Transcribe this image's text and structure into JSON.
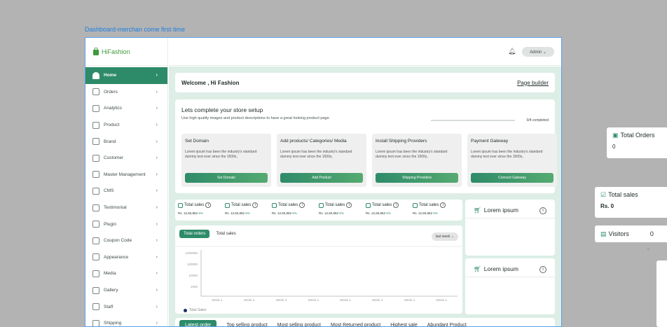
{
  "canvas_label": "Dashboard-merchan come first time",
  "brand": {
    "name": "HiFashion"
  },
  "header": {
    "user": "Admin ⌄"
  },
  "sidebar": {
    "items": [
      {
        "label": "Home",
        "icon": "home-icon"
      },
      {
        "label": "Orders",
        "icon": "orders-icon"
      },
      {
        "label": "Analytics",
        "icon": "analytics-icon"
      },
      {
        "label": "Product",
        "icon": "product-icon"
      },
      {
        "label": "Brand",
        "icon": "brand-icon"
      },
      {
        "label": "Customer",
        "icon": "customer-icon"
      },
      {
        "label": "Master Management",
        "icon": "master-icon"
      },
      {
        "label": "CMS",
        "icon": "cms-icon"
      },
      {
        "label": "Testimonial",
        "icon": "testimonial-icon"
      },
      {
        "label": "Plugin",
        "icon": "plugin-icon"
      },
      {
        "label": "Coupon Code",
        "icon": "coupon-icon"
      },
      {
        "label": "Appearance",
        "icon": "appearance-icon"
      },
      {
        "label": "Media",
        "icon": "media-icon"
      },
      {
        "label": "Gallery",
        "icon": "gallery-icon"
      },
      {
        "label": "Staff",
        "icon": "staff-icon"
      },
      {
        "label": "Shipping",
        "icon": "shipping-icon"
      }
    ]
  },
  "welcome": {
    "title": "Welcome , Hi Fashion",
    "page_builder": "Page builder"
  },
  "setup": {
    "title": "Lets complete your store setup",
    "subtitle": "Use high quality images and product descriptions to have a great looking product page.",
    "progress_text": "0/4 completed",
    "progress": 0,
    "steps": [
      {
        "title": "Set Domain",
        "desc": "Lorem ipsum has been the industry's standard dummy text ever since the 1500s,",
        "button": "Set Domain"
      },
      {
        "title": "Add products/ Categories/ Media",
        "desc": "Lorem ipsum has been the industry's standard dummy text ever since the 1500s,",
        "button": "Add Product"
      },
      {
        "title": "Install Shipping Providers",
        "desc": "Lorem ipsum has been the industry's standard dummy text ever since the 1500s,",
        "button": "Shipping Providers"
      },
      {
        "title": "Payment Gateway",
        "desc": "Lorem ipsum has been the industry's standard dummy text ever since the 1500s,",
        "button": "Connect Gateway"
      }
    ]
  },
  "stats": [
    {
      "label": "Total sales",
      "value": "Rs. 12,50,852",
      "pct": "5%"
    },
    {
      "label": "Total sales",
      "value": "Rs. 12,50,852",
      "pct": "5%"
    },
    {
      "label": "Total sales",
      "value": "Rs. 12,50,852",
      "pct": "5%"
    },
    {
      "label": "Total sales",
      "value": "Rs. 12,50,852",
      "pct": "5%"
    },
    {
      "label": "Total sales",
      "value": "Rs. 12,50,852",
      "pct": "5%"
    },
    {
      "label": "Total sales",
      "value": "Rs. 12,50,852",
      "pct": "5%"
    }
  ],
  "chart_tabs": {
    "active": "Total orders",
    "other": "Total sales",
    "period": "last week ⌄"
  },
  "chart_data": {
    "type": "line",
    "categories": [
      "Week 1",
      "Week 2",
      "Week 3",
      "Week 4",
      "Week 4",
      "Week 4",
      "Week 4",
      "Week 4"
    ],
    "y_ticks": [
      "1000000",
      "100000",
      "10000",
      "1000"
    ],
    "series": [
      {
        "name": "Total Sales",
        "values": []
      }
    ]
  },
  "side_cards": [
    {
      "title": "Lorem ipsum"
    },
    {
      "title": "Lorem ipsum"
    }
  ],
  "bottom_tabs": [
    "Latest order",
    "Top selling product",
    "Most selling product",
    "Most Returned product",
    "Highest sale",
    "Abundant Product"
  ],
  "floating": {
    "orders": {
      "label": "Total Orders",
      "value": "0"
    },
    "sales": {
      "label": "Total sales",
      "value": "Rs. 0"
    },
    "visitors": {
      "label": "Visitors",
      "value": "0"
    }
  }
}
